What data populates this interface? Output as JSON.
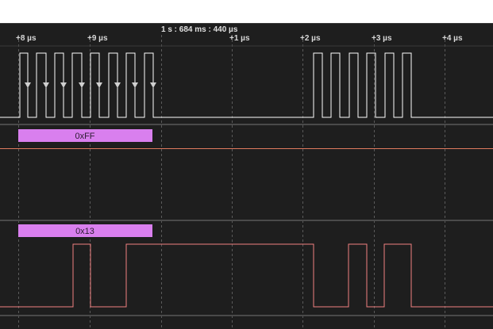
{
  "timeline": {
    "absolute_time": "1 s : 684 ms : 440 µs",
    "ticks": [
      "+8 µs",
      "+9 µs",
      "+1 µs",
      "+2 µs",
      "+3 µs",
      "+4 µs"
    ]
  },
  "channels": [
    {
      "name": "",
      "color": "#ffffff",
      "decoded_byte": "0xFF",
      "annotation_color": "#d97fee",
      "separator_color": "#e07a5f"
    },
    {
      "name": "",
      "color": "#f08080",
      "decoded_byte": "0x13",
      "annotation_color": "#d97fee"
    }
  ]
}
